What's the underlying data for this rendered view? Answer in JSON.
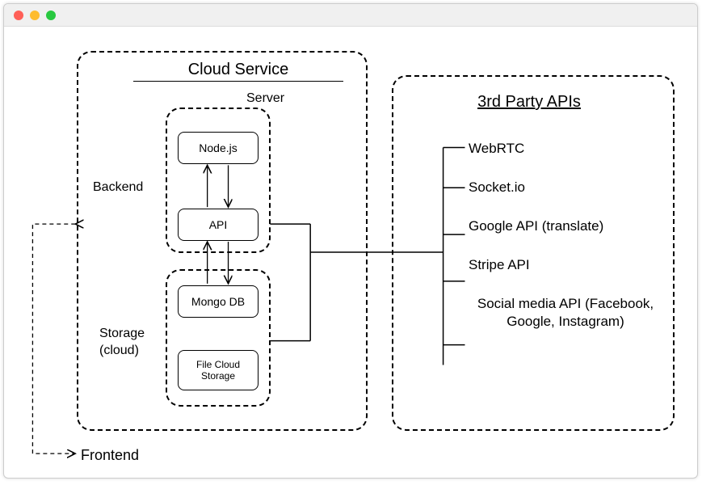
{
  "cloud": {
    "title": "Cloud Service",
    "server_label": "Server",
    "backend_label": "Backend",
    "storage_label": "Storage\n(cloud)",
    "boxes": {
      "nodejs": "Node.js",
      "api": "API",
      "mongodb": "Mongo DB",
      "file_cloud": "File Cloud Storage"
    }
  },
  "third_party": {
    "title": "3rd Party APIs",
    "items": {
      "webrtc": "WebRTC",
      "socketio": "Socket.io",
      "google": "Google API (translate)",
      "stripe": "Stripe API",
      "social": "Social media API (Facebook, Google, Instagram)"
    }
  },
  "frontend_label": "Frontend"
}
